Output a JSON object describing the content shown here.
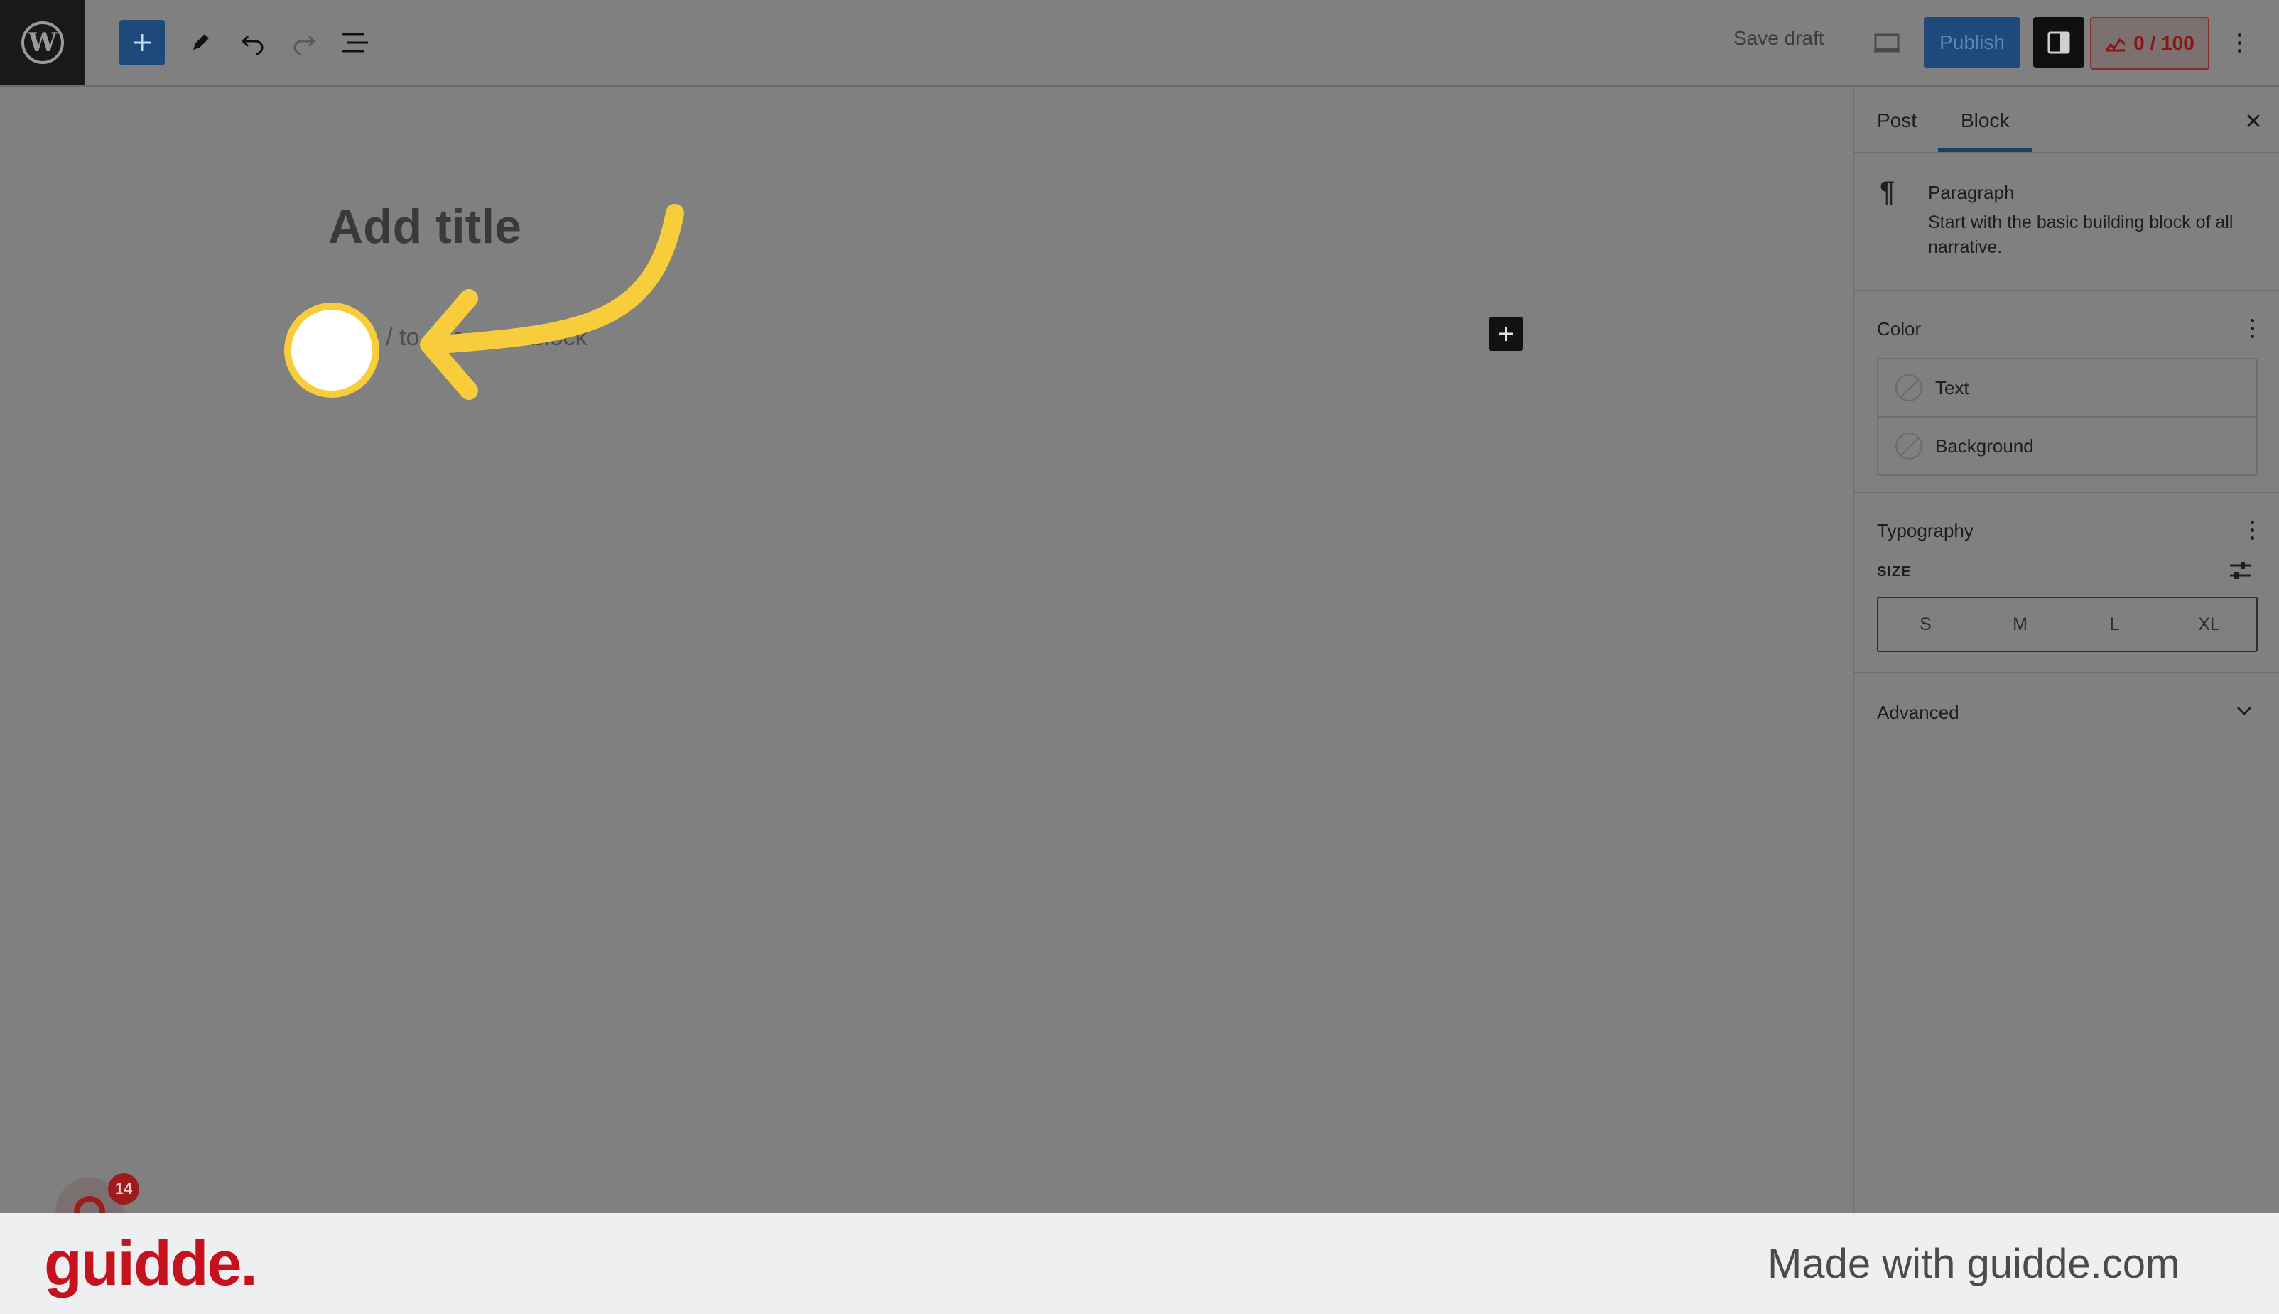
{
  "toolbar": {
    "logo_icon": "wordpress-logo-icon",
    "add_block_icon": "plus-icon",
    "tools_icon": "pencil-icon",
    "undo_icon": "undo-icon",
    "redo_icon": "redo-icon",
    "list_view_icon": "list-view-icon",
    "save_draft_label": "Save draft",
    "preview_icon": "laptop-icon",
    "publish_label": "Publish",
    "settings_icon": "sidebar-toggle-icon",
    "seo_score": "0 / 100",
    "more_icon": "vertical-ellipsis-icon"
  },
  "editor": {
    "title_placeholder": "Add title",
    "paragraph_placeholder": "Type / to choose a block"
  },
  "sidebar": {
    "tabs": [
      {
        "label": "Post"
      },
      {
        "label": "Block"
      }
    ],
    "active_tab": "Block",
    "block_card": {
      "icon": "¶",
      "name": "Paragraph",
      "description": "Start with the basic building block of all narrative."
    },
    "color_panel": {
      "title": "Color",
      "items": [
        {
          "label": "Text"
        },
        {
          "label": "Background"
        }
      ]
    },
    "typography_panel": {
      "title": "Typography",
      "size_label": "SIZE",
      "sizes": [
        "S",
        "M",
        "L",
        "XL"
      ]
    },
    "advanced_panel": {
      "title": "Advanced"
    }
  },
  "footer": {
    "brand": "guidde.",
    "made_with": "Made with guidde.com",
    "notification_count": "14"
  },
  "colors": {
    "overlay": "#808080",
    "accent": "#f7cd3b",
    "brand": "#c4121f",
    "publish": "#1d4a7a"
  }
}
